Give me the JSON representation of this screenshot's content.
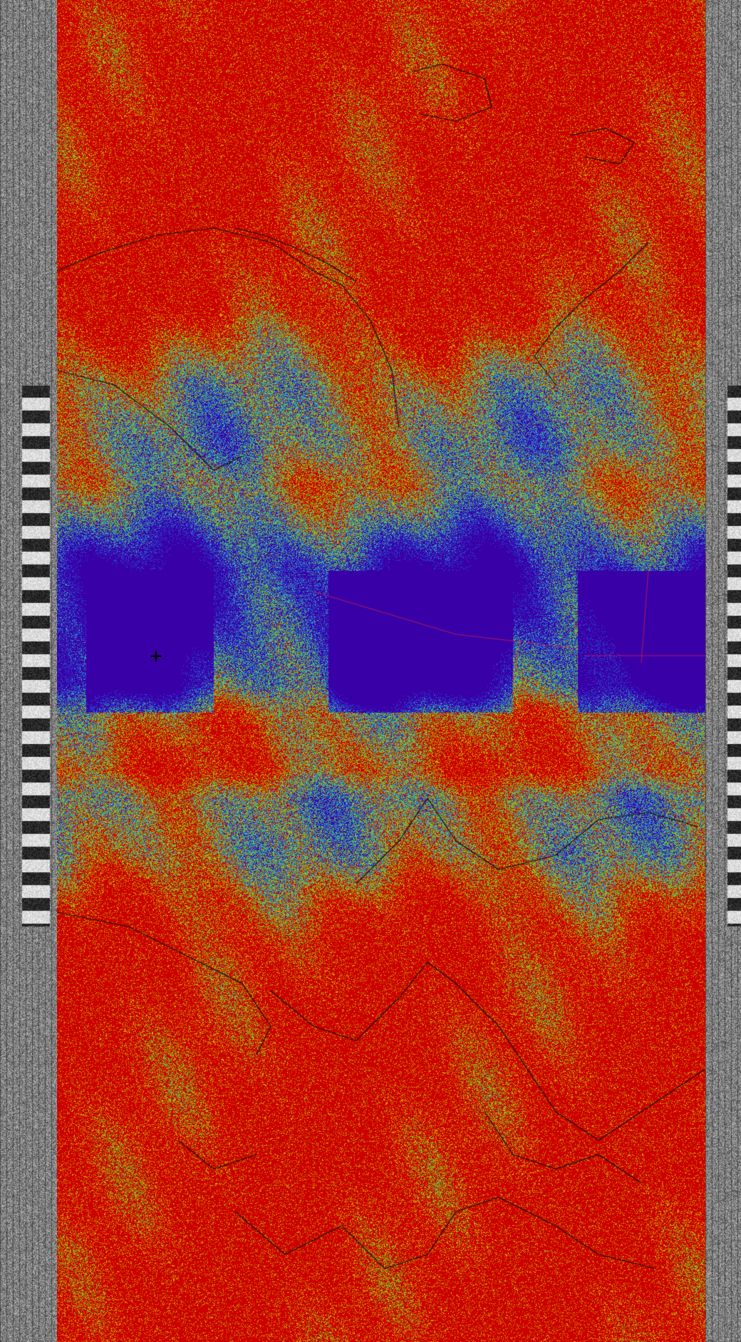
{
  "image": {
    "kind": "satellite-false-color-weather-image",
    "palette": {
      "land": "#cc0000",
      "land_speckle": "#c8b000",
      "cloud_core": "#3a00a8",
      "cloud_mid": "#1f5bd6",
      "cloud_edge": "#3ab7b0",
      "cloud_fringe": "#6fc020",
      "coastline": "#111111",
      "grid_line": "#ff2a2a"
    },
    "side_strips": {
      "left": "grayscale-noise-telemetry",
      "right": "grayscale-noise-telemetry"
    },
    "marker_symbol": "+"
  }
}
